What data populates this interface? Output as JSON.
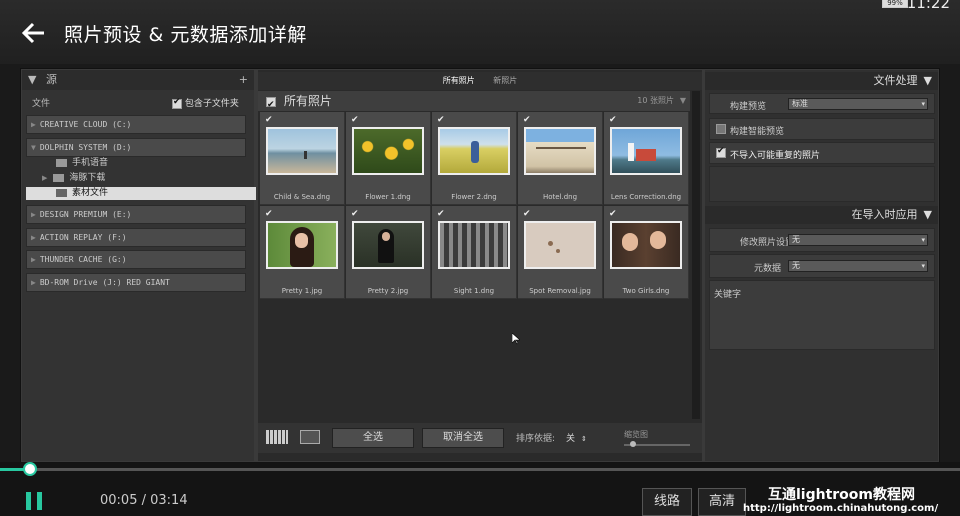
{
  "status": {
    "time": "11:22",
    "battery": "99%"
  },
  "video": {
    "title": "照片预设 & 元数据添加详解",
    "current": "00:05",
    "duration": "03:14",
    "progress": 0.027,
    "route_label": "线路",
    "quality_label": "高清",
    "accent": "#28c8a0"
  },
  "watermark": {
    "line1": "互通lightroom教程网",
    "line2": "http://lightroom.chinahutong.com/"
  },
  "source_panel": {
    "header": "源",
    "files_label": "文件",
    "include_subfolders": "包含子文件夹",
    "volumes": [
      "CREATIVE CLOUD (C:)",
      "DOLPHIN SYSTEM (D:)",
      "DESIGN PREMIUM (E:)",
      "ACTION REPLAY (F:)",
      "THUNDER CACHE (G:)",
      "BD-ROM Drive (J:) RED GIANT"
    ],
    "folders": [
      "手机语音",
      "海豚下载",
      "素材文件"
    ]
  },
  "center": {
    "tabs": [
      "所有照片",
      "新照片"
    ],
    "all_photos": "所有照片",
    "count": "10 张照片",
    "thumbnails": [
      {
        "name": "Child & Sea.dng",
        "checked": true
      },
      {
        "name": "Flower 1.dng",
        "checked": true
      },
      {
        "name": "Flower 2.dng",
        "checked": true
      },
      {
        "name": "Hotel.dng",
        "checked": true
      },
      {
        "name": "Lens Correction.dng",
        "checked": true
      },
      {
        "name": "Pretty 1.jpg",
        "checked": true
      },
      {
        "name": "Pretty 2.jpg",
        "checked": true
      },
      {
        "name": "Sight 1.dng",
        "checked": true
      },
      {
        "name": "Spot Removal.jpg",
        "checked": true
      },
      {
        "name": "Two Girls.dng",
        "checked": true
      }
    ],
    "select_all": "全选",
    "deselect_all": "取消全选",
    "sort_label": "排序依据:",
    "sort_value": "关",
    "zoom_label": "缩览图"
  },
  "right_panel": {
    "file_handling": "文件处理",
    "build_previews_label": "构建预览",
    "build_previews_value": "标准",
    "build_smart_previews": "构建智能预览",
    "dont_import_duplicates": "不导入可能重复的照片",
    "apply_during_import": "在导入时应用",
    "develop_settings_label": "修改照片设置",
    "develop_settings_value": "无",
    "metadata_label": "元数据",
    "metadata_value": "无",
    "keywords_label": "关键字"
  }
}
